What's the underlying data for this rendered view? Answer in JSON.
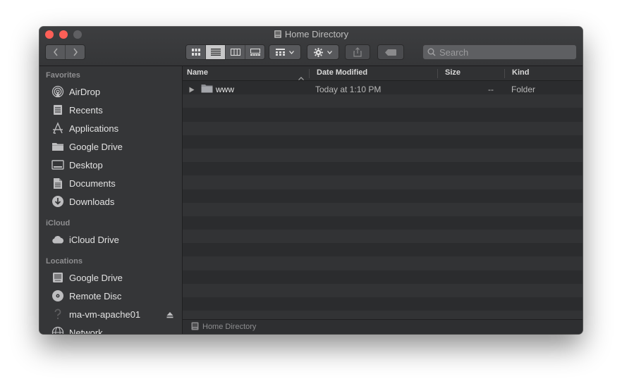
{
  "window": {
    "title": "Home Directory"
  },
  "toolbar": {
    "back_icon": "chevron-left-icon",
    "forward_icon": "chevron-right-icon",
    "view_modes": [
      "icon-view",
      "list-view",
      "column-view",
      "gallery-view"
    ],
    "active_view": "list-view",
    "search_placeholder": "Search"
  },
  "sidebar": {
    "sections": [
      {
        "title": "Favorites",
        "items": [
          {
            "label": "AirDrop",
            "icon": "airdrop-icon"
          },
          {
            "label": "Recents",
            "icon": "recents-icon"
          },
          {
            "label": "Applications",
            "icon": "applications-icon"
          },
          {
            "label": "Google Drive",
            "icon": "folder-icon"
          },
          {
            "label": "Desktop",
            "icon": "desktop-icon"
          },
          {
            "label": "Documents",
            "icon": "documents-icon"
          },
          {
            "label": "Downloads",
            "icon": "downloads-icon"
          }
        ]
      },
      {
        "title": "iCloud",
        "items": [
          {
            "label": "iCloud Drive",
            "icon": "cloud-icon"
          }
        ]
      },
      {
        "title": "Locations",
        "items": [
          {
            "label": "Google Drive",
            "icon": "drive-icon"
          },
          {
            "label": "Remote Disc",
            "icon": "disc-icon"
          },
          {
            "label": "ma-vm-apache01",
            "icon": "question-icon"
          },
          {
            "label": "Network",
            "icon": "network-icon"
          }
        ]
      }
    ]
  },
  "columns": {
    "name": "Name",
    "date": "Date Modified",
    "size": "Size",
    "kind": "Kind"
  },
  "files": [
    {
      "name": "www",
      "date_modified": "Today at 1:10 PM",
      "size": "--",
      "kind": "Folder"
    }
  ],
  "pathbar": {
    "label": "Home Directory"
  },
  "colors": {
    "traffic_close": "#fd5f57",
    "traffic_minimize": "#fd5f57",
    "window_bg": "#2b2c2e",
    "sidebar_bg": "#353638"
  }
}
